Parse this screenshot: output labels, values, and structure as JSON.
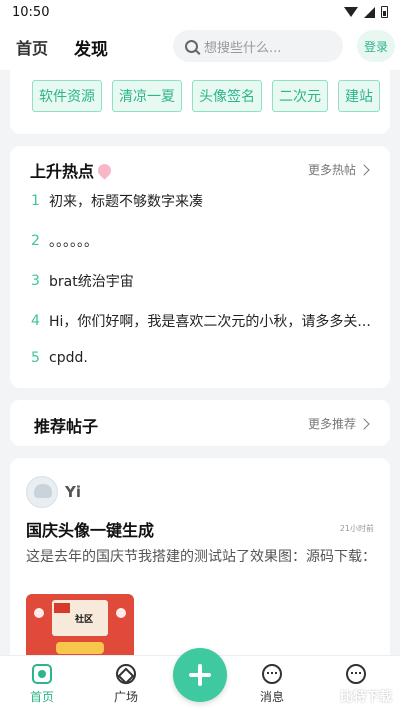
{
  "status_bar": {
    "time": "10:50"
  },
  "header": {
    "tabs": [
      {
        "label": "首页"
      },
      {
        "label": "发现"
      }
    ],
    "search": {
      "placeholder": "想搜些什么..."
    },
    "login_label": "登录"
  },
  "tags": [
    "软件资源",
    "清凉一夏",
    "头像签名",
    "二次元",
    "建站"
  ],
  "hot": {
    "title": "上升热点",
    "more_label": "更多热帖",
    "items": [
      {
        "rank": "1",
        "text": "初来，标题不够数字来凑"
      },
      {
        "rank": "2",
        "text": "。。。。。。"
      },
      {
        "rank": "3",
        "text": "brat统治宇宙"
      },
      {
        "rank": "4",
        "text": "Hi，你们好啊，我是喜欢二次元的小秋，请多多关..."
      },
      {
        "rank": "5",
        "text": "cpdd."
      }
    ]
  },
  "recommend": {
    "title": "推荐帖子",
    "more_label": "更多推荐"
  },
  "post": {
    "author": "Yi",
    "title": "国庆头像一键生成",
    "time": "21小时前",
    "body": "这是去年的国庆节我搭建的测试站了效果图：源码下载：",
    "image_caption": "社区"
  },
  "bottom_nav": {
    "items": [
      {
        "label": "首页"
      },
      {
        "label": "广场"
      },
      {
        "label": "消息"
      }
    ]
  },
  "watermark": "比特下载"
}
